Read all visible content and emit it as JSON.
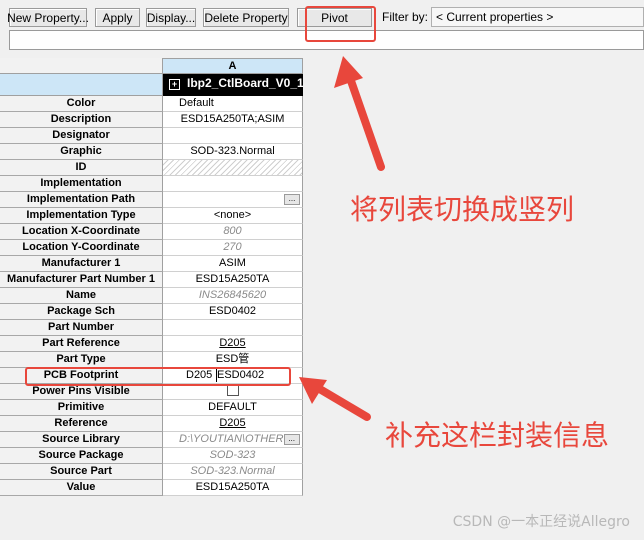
{
  "toolbar": {
    "new_property": "New Property...",
    "apply": "Apply",
    "display": "Display...",
    "delete_property": "Delete Property",
    "pivot": "Pivot",
    "filter_label": "Filter by:",
    "filter_value": "< Current properties >"
  },
  "grid": {
    "column_header": "A",
    "part_name": "Ibp2_CtlBoard_V0_1 :",
    "rows": [
      {
        "label": "Color",
        "value": "Default"
      },
      {
        "label": "Description",
        "value": "ESD15A250TA;ASIM"
      },
      {
        "label": "Designator",
        "value": ""
      },
      {
        "label": "Graphic",
        "value": "SOD-323.Normal"
      },
      {
        "label": "ID",
        "value": ""
      },
      {
        "label": "Implementation",
        "value": ""
      },
      {
        "label": "Implementation Path",
        "value": ""
      },
      {
        "label": "Implementation Type",
        "value": "<none>"
      },
      {
        "label": "Location X-Coordinate",
        "value": "800"
      },
      {
        "label": "Location Y-Coordinate",
        "value": "270"
      },
      {
        "label": "Manufacturer 1",
        "value": "ASIM"
      },
      {
        "label": "Manufacturer Part Number 1",
        "value": "ESD15A250TA"
      },
      {
        "label": "Name",
        "value": "INS26845620"
      },
      {
        "label": "Package Sch",
        "value": "ESD0402"
      },
      {
        "label": "Part Number",
        "value": ""
      },
      {
        "label": "Part Reference",
        "value": "D205"
      },
      {
        "label": "Part Type",
        "value": "ESD管"
      },
      {
        "label": "PCB Footprint",
        "value": "D205",
        "value_behind": "ESD0402"
      },
      {
        "label": "Power Pins Visible",
        "value": ""
      },
      {
        "label": "Primitive",
        "value": "DEFAULT"
      },
      {
        "label": "Reference",
        "value": "D205"
      },
      {
        "label": "Source Library",
        "value": "D:\\YOUTIAN\\OTHER\\C"
      },
      {
        "label": "Source Package",
        "value": "SOD-323"
      },
      {
        "label": "Source Part",
        "value": "SOD-323.Normal"
      },
      {
        "label": "Value",
        "value": "ESD15A250TA"
      }
    ]
  },
  "annotations": {
    "pivot_note": "将列表切换成竖列",
    "footprint_note": "补充这栏封装信息",
    "color": "#e8473c"
  },
  "watermark": "CSDN @一本正经说Allegro"
}
